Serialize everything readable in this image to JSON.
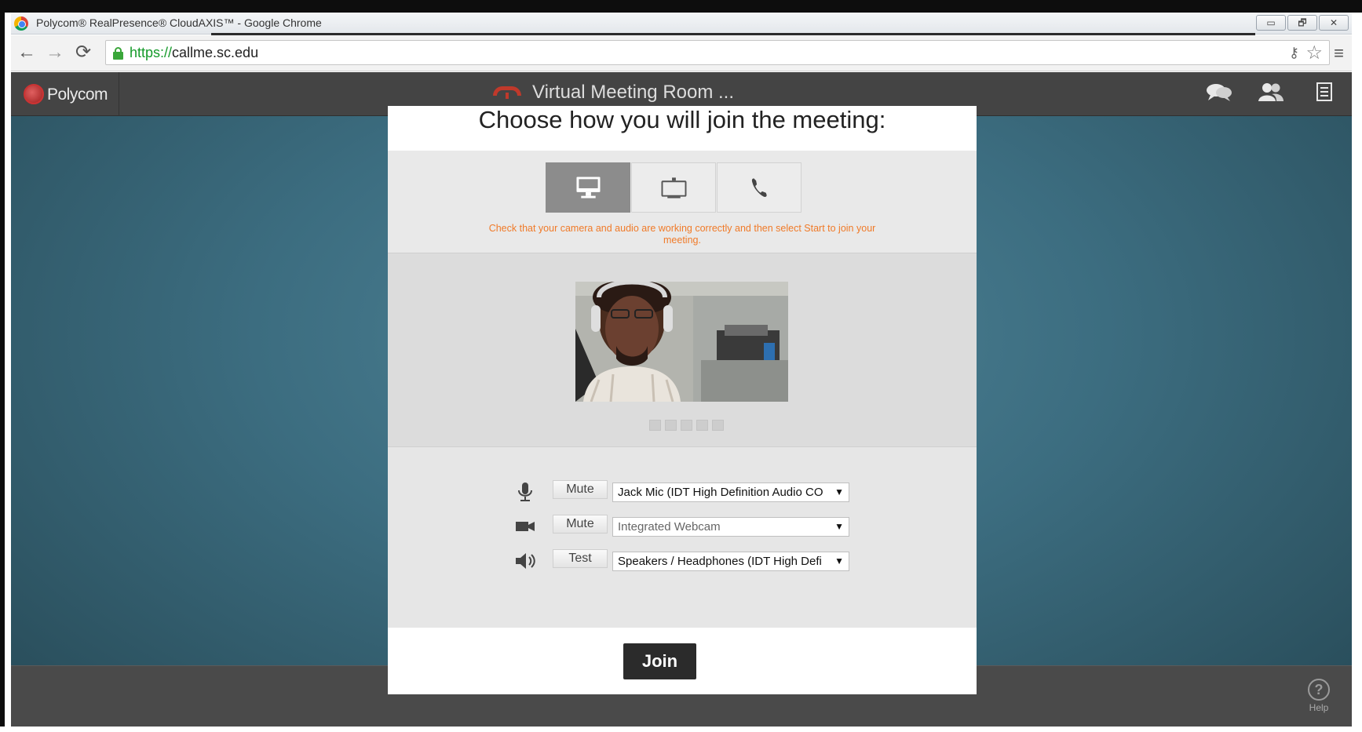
{
  "browser": {
    "window_title": "Polycom® RealPresence® CloudAXIS™ - Google Chrome",
    "window_controls": {
      "minimize": "▭",
      "restore": "🗗",
      "close": "✕"
    },
    "url_scheme": "https://",
    "url_host": "callme.sc.edu",
    "nav": {
      "back": "←",
      "forward": "→",
      "reload": "⟳"
    },
    "star": "☆",
    "key": "⚷",
    "menu": "≡"
  },
  "app": {
    "brand": "Polycom",
    "call_title": "Virtual Meeting Room ...",
    "header_icons": [
      "chat-icon",
      "participants-icon",
      "notes-icon"
    ],
    "help_label": "Help",
    "help_glyph": "?"
  },
  "dialog": {
    "title": "Choose how you will join the meeting:",
    "modes": [
      {
        "name": "computer",
        "icon": "desktop-icon",
        "active": true
      },
      {
        "name": "room-system",
        "icon": "tv-icon",
        "active": false
      },
      {
        "name": "phone",
        "icon": "phone-icon",
        "active": false
      }
    ],
    "instructions": "Check that your camera and audio are working correctly and then select Start to join your meeting.",
    "audio_meter_segments": 5,
    "devices": {
      "microphone": {
        "button": "Mute",
        "selected": "Jack Mic (IDT High Definition Audio CO"
      },
      "camera": {
        "button": "Mute",
        "selected": "Integrated Webcam"
      },
      "speakers": {
        "button": "Test",
        "selected": "Speakers / Headphones (IDT High Defi"
      }
    },
    "join_label": "Join"
  },
  "colors": {
    "accent_orange": "#f07a28",
    "header_bg": "#444444",
    "teal_bg": "#3c6d80",
    "join_bg": "#2b2b2b"
  }
}
